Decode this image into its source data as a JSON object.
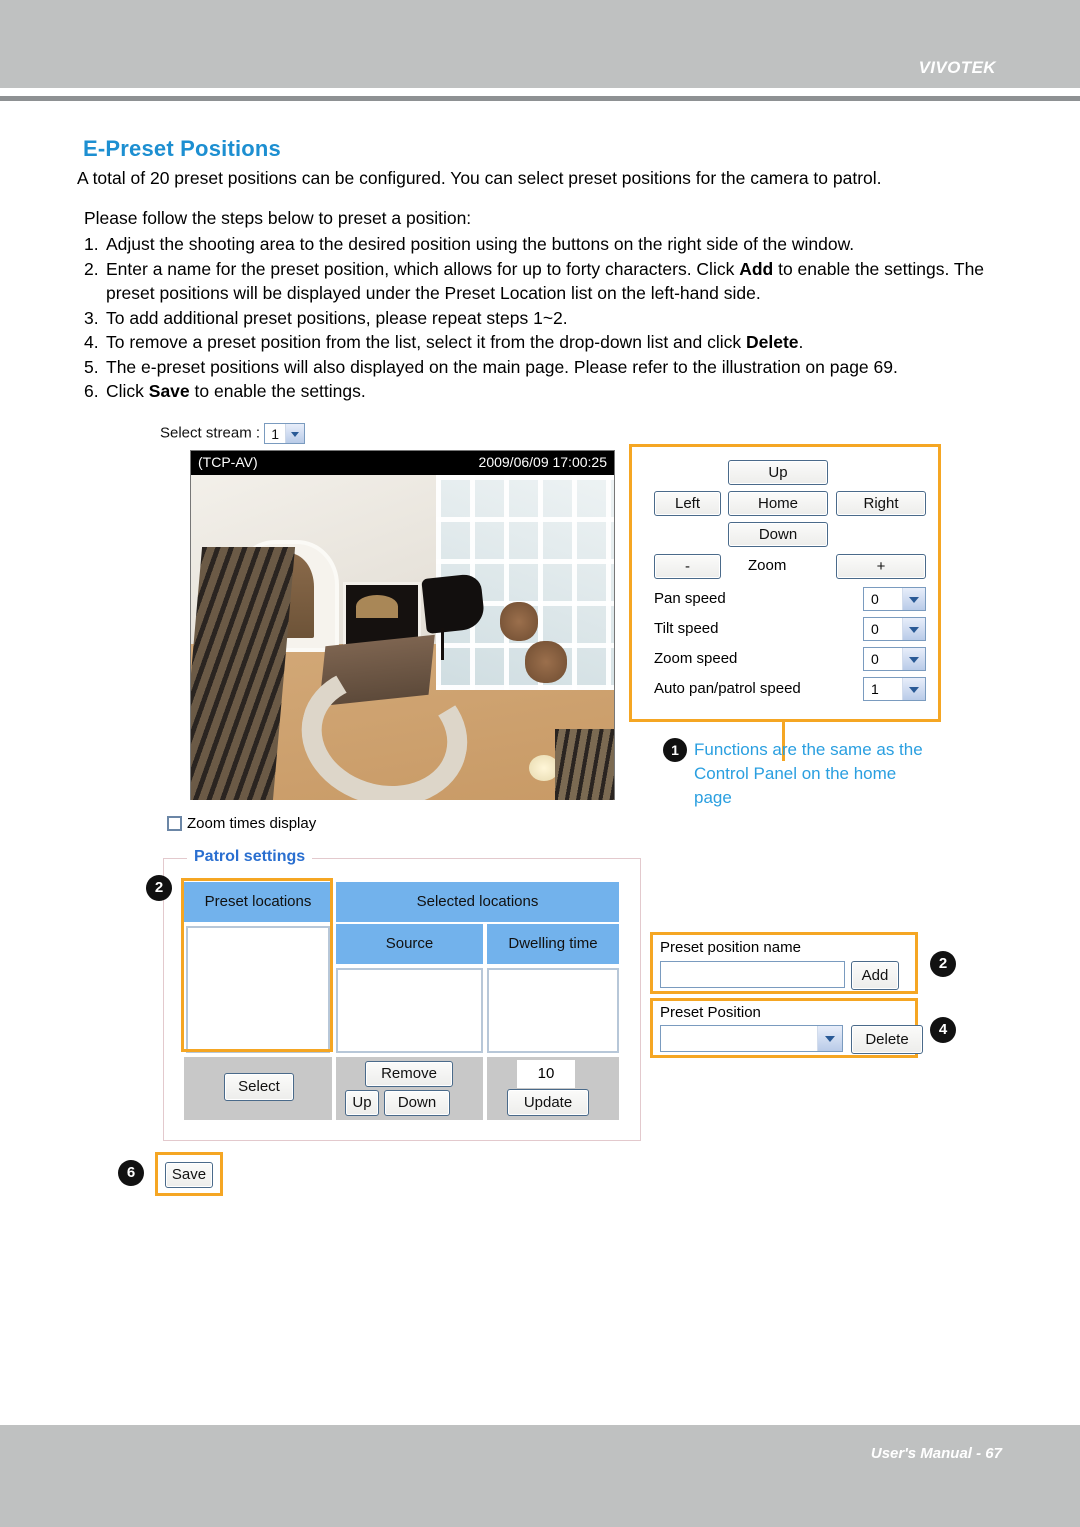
{
  "header": {
    "brand": "VIVOTEK"
  },
  "footer": {
    "text": "User's Manual - 67"
  },
  "document": {
    "title": "E-Preset Positions",
    "intro": "A total of 20 preset positions can be configured. You can select preset positions for the camera to patrol.",
    "steps_lead": "Please follow the steps below to preset a position:",
    "steps": [
      {
        "num": "1.",
        "text_a": "Adjust the shooting area to the desired position using the buttons on the right side of the window.",
        "bold": "",
        "text_b": ""
      },
      {
        "num": "2.",
        "text_a": "Enter a name for the preset position, which allows for up to forty characters. Click ",
        "bold": "Add",
        "text_b": " to enable the settings. The preset positions will be displayed under the Preset Location list on the left-hand side."
      },
      {
        "num": "3.",
        "text_a": "To add additional preset positions, please repeat steps 1~2.",
        "bold": "",
        "text_b": ""
      },
      {
        "num": "4.",
        "text_a": "To remove a preset position from the list, select it from the drop-down list and click ",
        "bold": "Delete",
        "text_b": "."
      },
      {
        "num": "5.",
        "text_a": "The e-preset positions will also displayed on the main page. Please refer to the illustration on page 69.",
        "bold": "",
        "text_b": ""
      },
      {
        "num": "6.",
        "text_a": "Click ",
        "bold": "Save",
        "text_b": " to enable the settings."
      }
    ]
  },
  "ui": {
    "select_stream_label": "Select stream :",
    "select_stream_value": "1",
    "video": {
      "protocol": "(TCP-AV)",
      "timestamp": "2009/06/09 17:00:25"
    },
    "zoom_times_display_label": "Zoom times display",
    "control_panel": {
      "up": "Up",
      "left": "Left",
      "home": "Home",
      "right": "Right",
      "down": "Down",
      "zoom_out": "-",
      "zoom_label": "Zoom",
      "zoom_in": "+",
      "speeds": [
        {
          "label": "Pan speed",
          "value": "0"
        },
        {
          "label": "Tilt speed",
          "value": "0"
        },
        {
          "label": "Zoom speed",
          "value": "0"
        },
        {
          "label": "Auto pan/patrol speed",
          "value": "1"
        }
      ]
    },
    "patrol": {
      "legend": "Patrol settings",
      "col_preset_locations": "Preset locations",
      "col_selected_locations": "Selected locations",
      "col_source": "Source",
      "col_dwelling_time": "Dwelling time",
      "btn_select": "Select",
      "btn_remove": "Remove",
      "btn_up": "Up",
      "btn_down": "Down",
      "dwelling_value": "10",
      "btn_update": "Update"
    },
    "preset_name": {
      "label": "Preset position name",
      "value": "",
      "btn_add": "Add"
    },
    "preset_position": {
      "label": "Preset Position",
      "value": "",
      "btn_delete": "Delete"
    },
    "btn_save": "Save",
    "callouts": {
      "one": "1",
      "one_text": "Functions are the same as the Control Panel on the home page",
      "two_left": "2",
      "two_right": "2",
      "four": "4",
      "six": "6"
    }
  },
  "colors": {
    "heading_blue": "#1d8fd1",
    "legend_blue": "#2a6fd0",
    "callout_blue": "#2a9fe0",
    "highlight_orange": "#f5a623",
    "table_header_blue": "#72b2ec",
    "chrome_gray": "#bfc1c1"
  }
}
